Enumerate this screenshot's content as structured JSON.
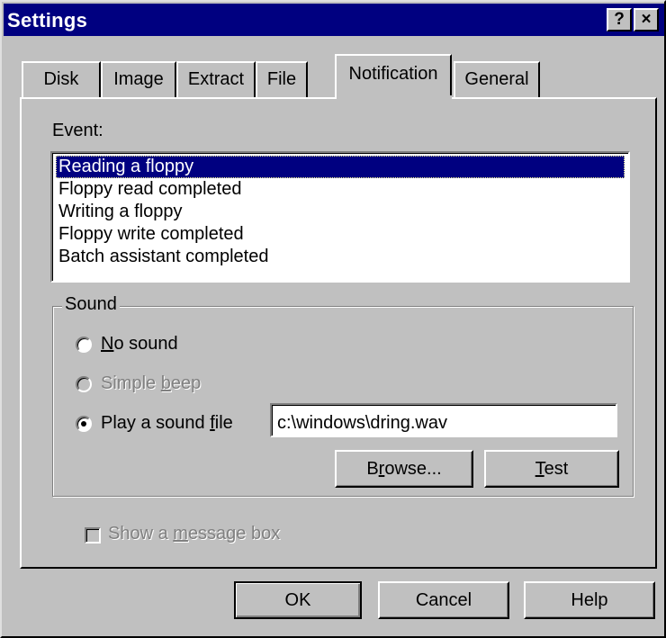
{
  "window": {
    "title": "Settings",
    "help_button": "?",
    "close_button": "×"
  },
  "tabs": [
    {
      "label": "Disk",
      "active": false
    },
    {
      "label": "Image",
      "active": false
    },
    {
      "label": "Extract",
      "active": false
    },
    {
      "label": "File",
      "active": false
    },
    {
      "label": "Notification",
      "active": true
    },
    {
      "label": "General",
      "active": false
    }
  ],
  "event": {
    "label": "Event:",
    "items": [
      "Reading a floppy",
      "Floppy read completed",
      "Writing a floppy",
      "Floppy write completed",
      "Batch assistant completed"
    ],
    "selected": "Reading a floppy"
  },
  "sound": {
    "group_label": "Sound",
    "no_sound": {
      "prefix": "",
      "accel": "N",
      "suffix": "o sound",
      "selected": false,
      "enabled": true
    },
    "simple_beep": {
      "prefix": "Simple ",
      "accel": "b",
      "suffix": "eep",
      "selected": false,
      "enabled": false
    },
    "play_file": {
      "prefix": "Play a sound ",
      "accel": "f",
      "suffix": "ile",
      "selected": true,
      "enabled": true
    },
    "file_path": "c:\\windows\\dring.wav",
    "browse": {
      "prefix": "B",
      "accel": "r",
      "suffix": "owse..."
    },
    "test": {
      "prefix": "",
      "accel": "T",
      "suffix": "est"
    }
  },
  "message_box": {
    "prefix": "Show a ",
    "accel": "m",
    "suffix": "essage box",
    "checked": false,
    "enabled": false
  },
  "footer": {
    "ok": "OK",
    "cancel": "Cancel",
    "help": "Help"
  }
}
